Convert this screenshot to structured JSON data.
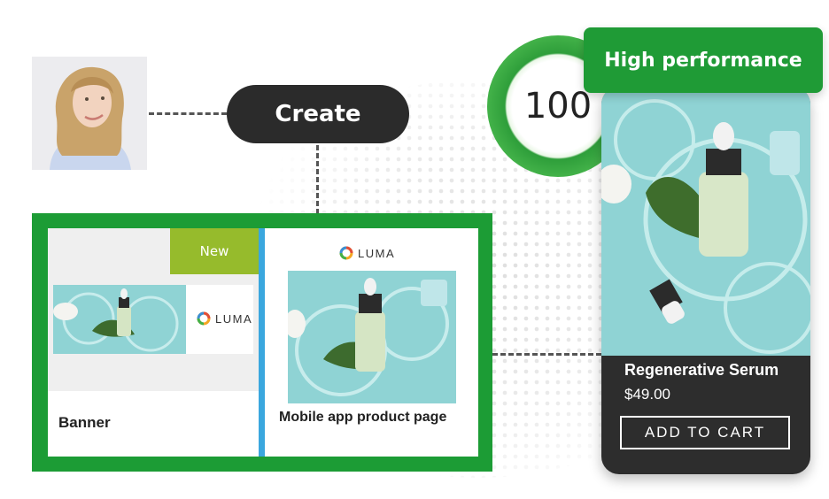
{
  "create_label": "Create",
  "score": "100",
  "badge_label": "High performance",
  "cards": {
    "banner": {
      "title": "Banner",
      "new_label": "New",
      "brand": "LUMA"
    },
    "mobile": {
      "title": "Mobile app product page",
      "brand": "LUMA"
    }
  },
  "product": {
    "name": "Regenerative Serum",
    "price": "$49.00",
    "cta": "ADD TO CART"
  },
  "colors": {
    "brand_green": "#1c9c35",
    "new_badge": "#96bb2c",
    "separator_blue": "#3aa7de",
    "product_card": "#2d2d2d",
    "teal": "#8fd3d4"
  }
}
